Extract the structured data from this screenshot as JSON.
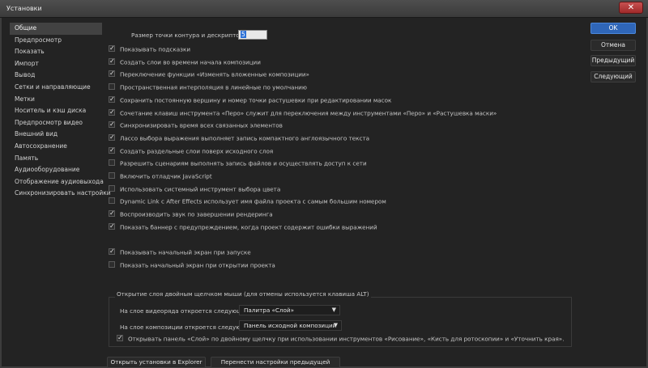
{
  "window": {
    "title": "Установки",
    "close_glyph": "✕"
  },
  "sidebar": {
    "items": [
      {
        "label": "Общие",
        "active": true
      },
      {
        "label": "Предпросмотр"
      },
      {
        "label": "Показать"
      },
      {
        "label": "Импорт"
      },
      {
        "label": "Вывод"
      },
      {
        "label": "Сетки и направляющие"
      },
      {
        "label": "Метки"
      },
      {
        "label": "Носитель и кэш диска"
      },
      {
        "label": "Предпросмотр видео"
      },
      {
        "label": "Внешний вид"
      },
      {
        "label": "Автосохранение"
      },
      {
        "label": "Память"
      },
      {
        "label": "Аудиооборудование"
      },
      {
        "label": "Отображение аудиовыхода"
      },
      {
        "label": "Синхронизировать настройки"
      }
    ]
  },
  "general": {
    "size_label": "Размер точки контура и дескриптора:",
    "size_value": "5",
    "options": [
      {
        "label": "Показывать подсказки",
        "checked": true
      },
      {
        "label": "Создать слои во времени начала композиции",
        "checked": true
      },
      {
        "label": "Переключение функции «Изменять вложенные композиции»",
        "checked": true
      },
      {
        "label": "Пространственная интерполяция в линейные по умолчанию",
        "checked": false
      },
      {
        "label": "Сохранить постоянную вершину и номер точки растушевки при редактировании масок",
        "checked": true
      },
      {
        "label": "Сочетание клавиш инструмента «Перо» служит для переключения между инструментами «Перо» и «Растушевка маски»",
        "checked": true
      },
      {
        "label": "Синхронизировать время всех связанных элементов",
        "checked": true
      },
      {
        "label": "Лассо выбора выражения выполняет запись компактного англоязычного текста",
        "checked": true
      },
      {
        "label": "Создать раздельные слои поверх исходного слоя",
        "checked": true
      },
      {
        "label": "Разрешить сценариям выполнять запись файлов и осуществлять доступ к сети",
        "checked": false
      },
      {
        "label": "Включить отладчик JavaScript",
        "checked": false
      },
      {
        "label": "Использовать системный инструмент выбора цвета",
        "checked": false
      },
      {
        "label": "Dynamic Link с After Effects использует имя файла проекта с самым большим номером",
        "checked": false
      },
      {
        "label": "Воспроизводить звук по завершении рендеринга",
        "checked": true
      },
      {
        "label": "Показать баннер с предупреждением, когда проект содержит ошибки выражений",
        "checked": true
      }
    ],
    "startup_options": [
      {
        "label": "Показывать начальный экран при запуске",
        "checked": true
      },
      {
        "label": "Показать начальный экран при открытии проекта",
        "checked": false
      }
    ],
    "group_label": "Открытие слоя двойным щелчком мыши (для отмены используется клавиша ALT)",
    "footage_label": "На слое видеоряда откроется следующее:",
    "footage_value": "Палитра «Слой»",
    "comp_label": "На слое композиции откроется следующее:",
    "comp_value": "Панель исходной композиции",
    "layer_panel_option": {
      "label": "Открывать панель «Слой» по двойному щелчку при использовании инструментов «Рисование», «Кисть для ротоскопии» и «Уточнить края».",
      "checked": true
    },
    "reveal_button": "Открыть установки в Explorer",
    "migrate_button": "Перенести настройки предыдущей версии..."
  },
  "buttons": {
    "ok": "OK",
    "cancel": "Отмена",
    "prev": "Предыдущий",
    "next": "Следующий"
  },
  "glyphs": {
    "check": "✓",
    "dropdown_arrow": "▼"
  }
}
